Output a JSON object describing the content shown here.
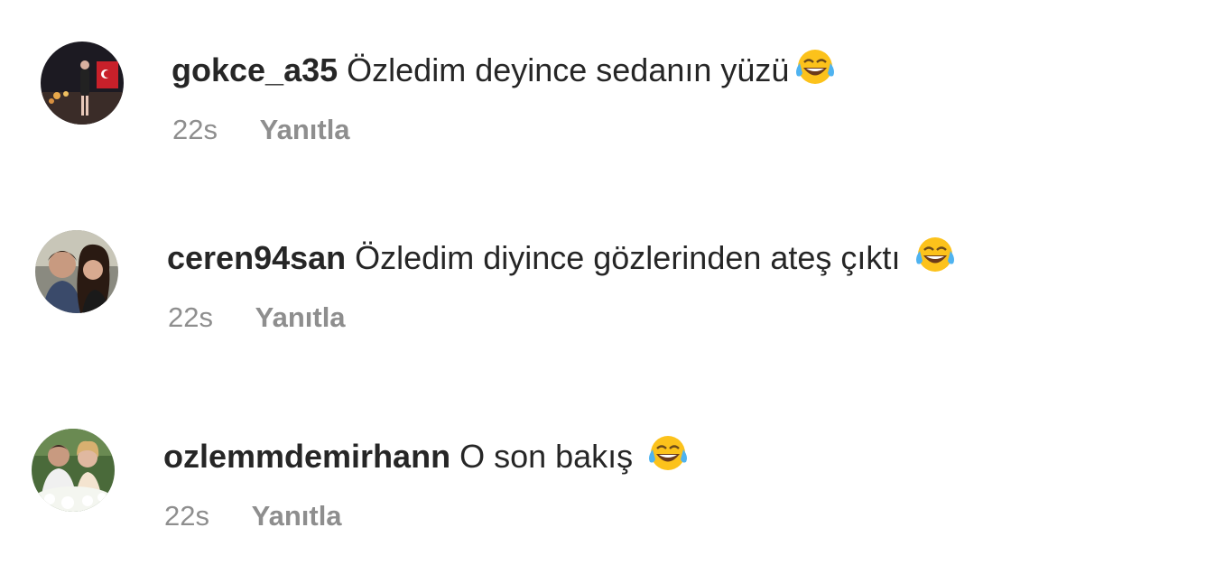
{
  "comments": [
    {
      "username": "gokce_a35",
      "text": "Özledim deyince sedanın yüzü",
      "emoji": "face-with-tears-of-joy",
      "time": "22s",
      "reply_label": "Yanıtla"
    },
    {
      "username": "ceren94san",
      "text": "Özledim diyince gözlerinden ateş çıktı",
      "emoji": "face-with-tears-of-joy",
      "time": "22s",
      "reply_label": "Yanıtla"
    },
    {
      "username": "ozlemmdemirhann",
      "text": "O son bakış",
      "emoji": "face-with-tears-of-joy",
      "time": "22s",
      "reply_label": "Yanıtla"
    }
  ],
  "colors": {
    "text": "#262626",
    "meta": "#8e8e8e",
    "background": "#ffffff",
    "emoji_face": "#fcc21b"
  }
}
